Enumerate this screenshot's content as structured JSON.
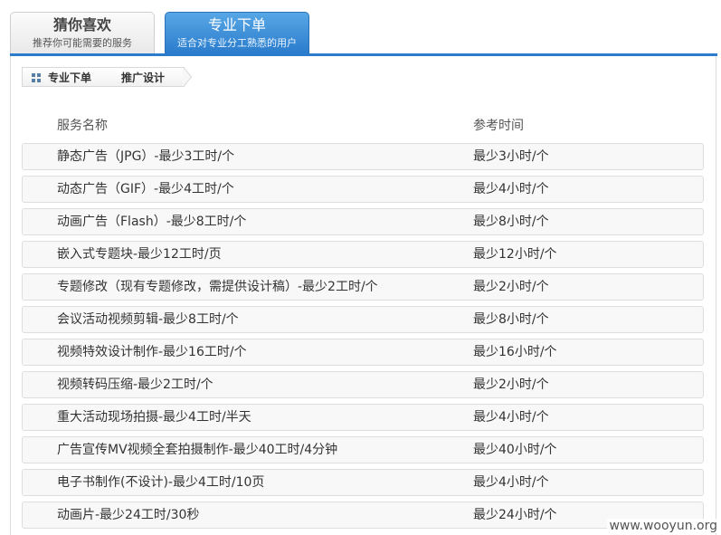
{
  "tabs": [
    {
      "title": "猜你喜欢",
      "subtitle": "推荐你可能需要的服务"
    },
    {
      "title": "专业下单",
      "subtitle": "适合对专业分工熟悉的用户"
    }
  ],
  "breadcrumb": [
    "专业下单",
    "推广设计"
  ],
  "table": {
    "headers": [
      "服务名称",
      "参考时间"
    ],
    "rows": [
      {
        "name": "静态广告（JPG）-最少3工时/个",
        "time": "最少3小时/个"
      },
      {
        "name": "动态广告（GIF）-最少4工时/个",
        "time": "最少4小时/个"
      },
      {
        "name": "动画广告（Flash）-最少8工时/个",
        "time": "最少8小时/个"
      },
      {
        "name": "嵌入式专题块-最少12工时/页",
        "time": "最少12小时/个"
      },
      {
        "name": "专题修改（现有专题修改，需提供设计稿）-最少2工时/个",
        "time": "最少2小时/个"
      },
      {
        "name": "会议活动视频剪辑-最少8工时/个",
        "time": "最少8小时/个"
      },
      {
        "name": "视频特效设计制作-最少16工时/个",
        "time": "最少16小时/个"
      },
      {
        "name": "视频转码压缩-最少2工时/个",
        "time": "最少2小时/个"
      },
      {
        "name": "重大活动现场拍摄-最少4工时/半天",
        "time": "最少4小时/个"
      },
      {
        "name": "广告宣传MV视频全套拍摄制作-最少40工时/4分钟",
        "time": "最少40小时/个"
      },
      {
        "name": "电子书制作(不设计)-最少4工时/10页",
        "time": "最少4小时/个"
      },
      {
        "name": "动画片-最少24工时/30秒",
        "time": "最少24小时/个"
      }
    ]
  },
  "watermark": "www.wooyun.org",
  "colors": {
    "accent": "#2b7ccc",
    "row_bg": "#f8f8f8",
    "row_border": "#dedede"
  }
}
